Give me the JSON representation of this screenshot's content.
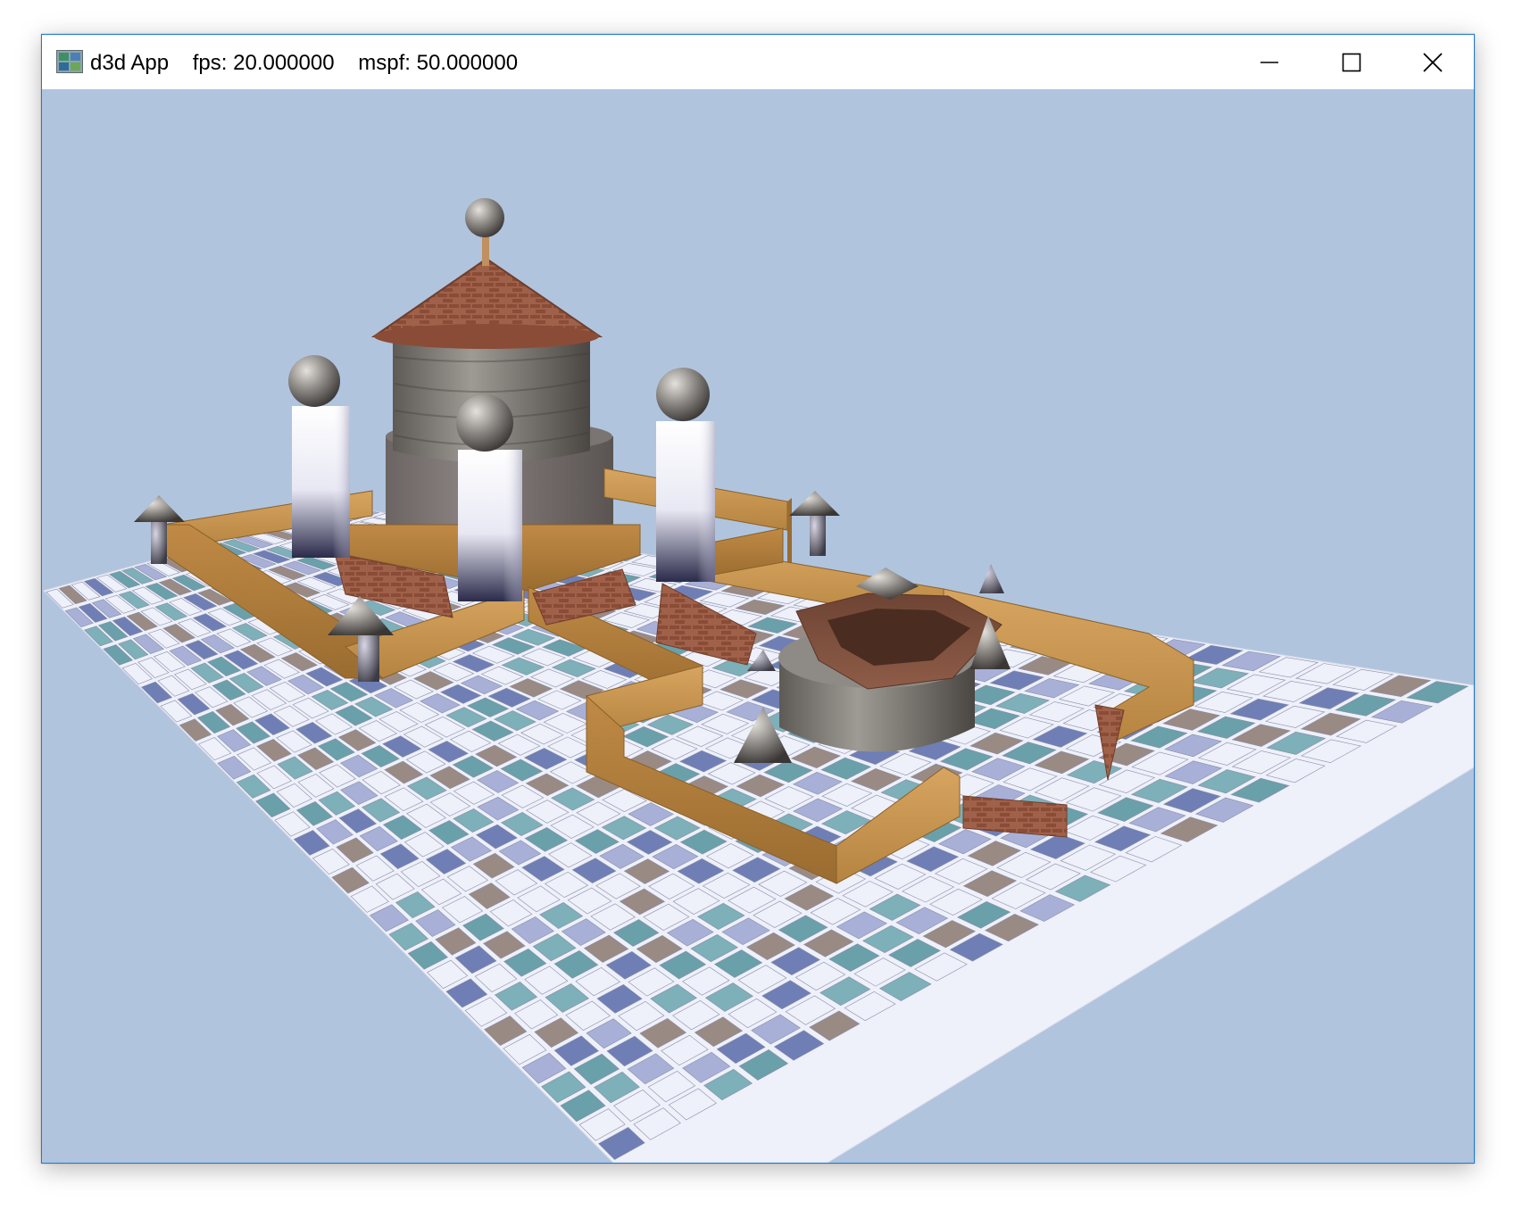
{
  "window": {
    "app_name": "d3d App",
    "fps_label": "fps: 20.000000",
    "mspf_label": "mspf: 50.000000"
  },
  "caption_buttons": {
    "minimize_icon": "minimize-icon",
    "maximize_icon": "maximize-icon",
    "close_icon": "close-icon"
  },
  "viewport": {
    "background_color": "#b0c4de",
    "scene_description_icons": [
      "tile-floor",
      "castle-tower",
      "pillars",
      "wooden-walls",
      "pyramids",
      "bowl"
    ]
  }
}
